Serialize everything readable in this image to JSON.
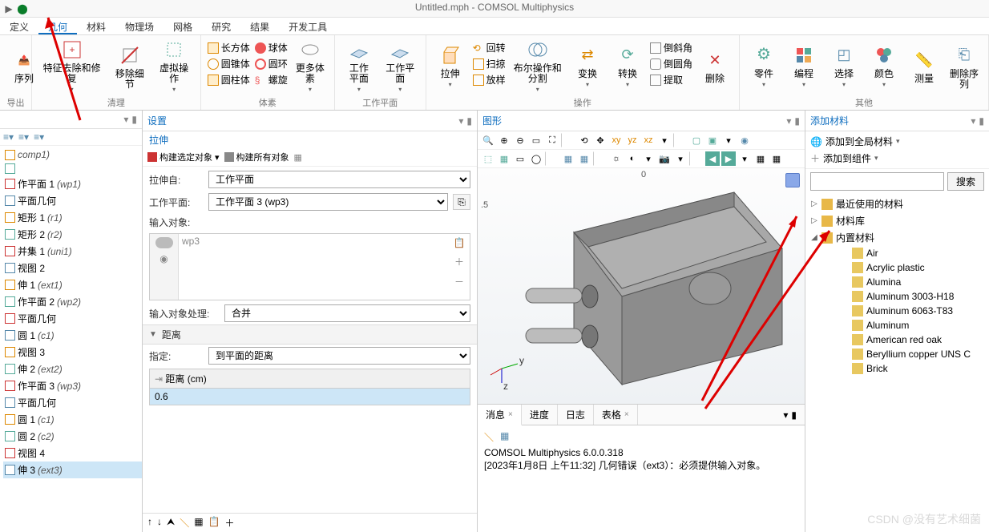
{
  "title": "Untitled.mph - COMSOL Multiphysics",
  "menu": {
    "items": [
      "定义",
      "几何",
      "材料",
      "物理场",
      "网格",
      "研究",
      "结果",
      "开发工具"
    ],
    "active": 1
  },
  "ribbon": {
    "export": {
      "label": "序列",
      "group": "导出"
    },
    "clean": {
      "btn1": "特征去除和修复",
      "btn2": "移除细节",
      "btn3": "虚拟操作",
      "group": "清理"
    },
    "prims": {
      "c1a": "长方体",
      "c1b": "圆锥体",
      "c1c": "圆柱体",
      "c2a": "球体",
      "c2b": "圆环",
      "c2c": "螺旋",
      "more": "更多体素",
      "group": "体素"
    },
    "wp": {
      "btn1": "工作\n平面",
      "btn2": "工作平面",
      "group": "工作平面"
    },
    "ops": {
      "ext": "拉伸",
      "rot": "回转",
      "sweep": "扫掠",
      "scale": "放样",
      "bool": "布尔操作和分割",
      "trans": "变换",
      "conv": "转换",
      "chamf": "倒斜角",
      "fillet": "倒圆角",
      "extract": "提取",
      "del": "删除",
      "group": "操作"
    },
    "other": {
      "parts": "零件",
      "prog": "编程",
      "sel": "选择",
      "color": "颜色",
      "meas": "测量",
      "delseq": "删除序列",
      "group": "其他"
    }
  },
  "tree": {
    "items": [
      {
        "t": "comp1)",
        "ital": true
      },
      {
        "t": ""
      },
      {
        "t": "作平面 1",
        "suf": "(wp1)"
      },
      {
        "t": "平面几何"
      },
      {
        "t": "矩形 1",
        "suf": "(r1)"
      },
      {
        "t": "矩形 2",
        "suf": "(r2)"
      },
      {
        "t": "并集 1",
        "suf": "(uni1)"
      },
      {
        "t": "视图 2"
      },
      {
        "t": "伸 1",
        "suf": "(ext1)"
      },
      {
        "t": "作平面 2",
        "suf": "(wp2)"
      },
      {
        "t": "平面几何"
      },
      {
        "t": "圆 1",
        "suf": "(c1)"
      },
      {
        "t": "视图 3"
      },
      {
        "t": "伸 2",
        "suf": "(ext2)"
      },
      {
        "t": "作平面 3",
        "suf": "(wp3)"
      },
      {
        "t": "平面几何"
      },
      {
        "t": "圆 1",
        "suf": "(c1)"
      },
      {
        "t": "圆 2",
        "suf": "(c2)"
      },
      {
        "t": "视图 4"
      },
      {
        "t": "伸 3",
        "suf": "(ext3)",
        "sel": true
      }
    ]
  },
  "settings": {
    "title": "设置",
    "subtitle": "拉伸",
    "build_sel": "构建选定对象",
    "build_all": "构建所有对象",
    "from_lbl": "拉伸自:",
    "from_val": "工作平面",
    "wp_lbl": "工作平面:",
    "wp_val": "工作平面 3 (wp3)",
    "inobj_lbl": "输入对象:",
    "inobj_item": "wp3",
    "inproc_lbl": "输入对象处理:",
    "inproc_val": "合并",
    "dist_hdr": "距离",
    "spec_lbl": "指定:",
    "spec_val": "到平面的距离",
    "tbl_hdr": "距离 (cm)",
    "tbl_val": "0.6"
  },
  "graphics": {
    "title": "图形",
    "axis_t": "0",
    "axis_l": ".5",
    "axis_y": "y",
    "axis_z": "z"
  },
  "msgs": {
    "tabs": [
      "消息",
      "进度",
      "日志",
      "表格"
    ],
    "line1": "COMSOL Multiphysics 6.0.0.318",
    "line2": "[2023年1月8日 上午11:32] 几何错误（ext3）：必须提供输入对象。"
  },
  "materials": {
    "title": "添加材料",
    "add_global": "添加到全局材料",
    "add_comp": "添加到组件",
    "search_btn": "搜索",
    "nodes": [
      {
        "t": "最近使用的材料",
        "lvl": 0,
        "chev": "▷",
        "icon": "folder"
      },
      {
        "t": "材料库",
        "lvl": 0,
        "chev": "▷",
        "icon": "folder"
      },
      {
        "t": "内置材料",
        "lvl": 0,
        "chev": "◢",
        "icon": "folder"
      },
      {
        "t": "Air",
        "lvl": 1
      },
      {
        "t": "Acrylic plastic",
        "lvl": 1
      },
      {
        "t": "Alumina",
        "lvl": 1
      },
      {
        "t": "Aluminum 3003-H18",
        "lvl": 1
      },
      {
        "t": "Aluminum 6063-T83",
        "lvl": 1
      },
      {
        "t": "Aluminum",
        "lvl": 1
      },
      {
        "t": "American red oak",
        "lvl": 1
      },
      {
        "t": "Beryllium copper UNS C",
        "lvl": 1
      },
      {
        "t": "Brick",
        "lvl": 1
      }
    ]
  },
  "watermark": "CSDN @没有艺术细菌"
}
